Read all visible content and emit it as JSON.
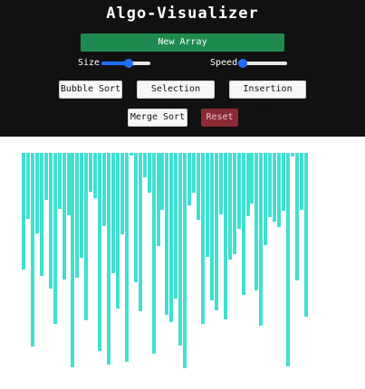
{
  "app": {
    "title": "Algo-Visualizer"
  },
  "controls": {
    "new_array_label": "New Array",
    "size_label": "Size",
    "speed_label": "Speed",
    "size_value": 0.55,
    "speed_value": 0.1,
    "bubble_sort_label": "Bubble Sort",
    "selection_sort_label": "Selection Sort",
    "insertion_sort_label": "Insertion Sort",
    "merge_sort_label": "Merge Sort",
    "reset_label": "Reset"
  },
  "colors": {
    "header_bg": "#111111",
    "primary_green": "#1e8a4f",
    "reset_red": "#8a2a35",
    "bar_color": "#40e0d0",
    "slider_accent": "#1f6fff"
  },
  "array": {
    "values": [
      129,
      73,
      214,
      89,
      136,
      52,
      150,
      189,
      62,
      140,
      69,
      237,
      138,
      116,
      185,
      43,
      50,
      219,
      81,
      234,
      133,
      172,
      90,
      231,
      3,
      143,
      175,
      27,
      44,
      222,
      103,
      63,
      179,
      187,
      161,
      213,
      238,
      58,
      44,
      74,
      189,
      115,
      163,
      174,
      68,
      184,
      118,
      112,
      84,
      157,
      70,
      56,
      152,
      191,
      102,
      71,
      76,
      82,
      64,
      236,
      4,
      141,
      63,
      181
    ]
  }
}
